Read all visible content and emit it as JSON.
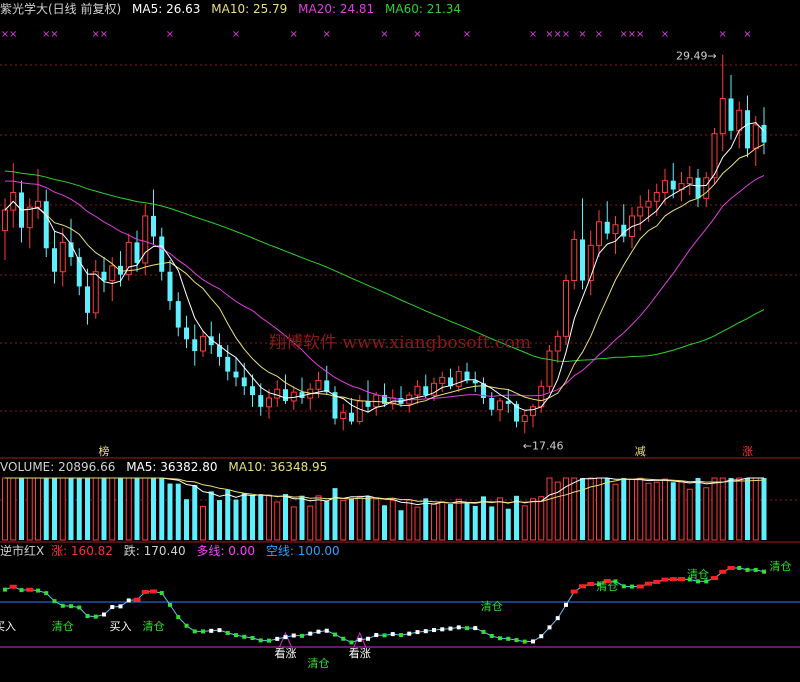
{
  "colors": {
    "up": "#ff3b3b",
    "down": "#5ff0ff",
    "ma5": "#ffffff",
    "ma10": "#e8e07a",
    "ma20": "#e040e0",
    "ma60": "#30d030",
    "rise": "#ff2020",
    "fall": "#00d0ff",
    "long": "#ff40ff",
    "short": "#3080ff",
    "grid": "#8b1a1a",
    "label": "#cccccc",
    "buy_line_blue": "#2a7fff",
    "buy_line_magenta": "#d030d0"
  },
  "price_header": {
    "name": "紫光学大(日线 前复权)",
    "ma5": "MA5: 26.63",
    "ma10": "MA10: 25.79",
    "ma20": "MA20: 24.81",
    "ma60": "MA60: 21.34"
  },
  "volume_header": {
    "title": "VOLUME: 20896.66",
    "ma5": "MA5: 36382.80",
    "ma10": "MA10: 36348.95"
  },
  "indicator_header": {
    "name": "逆市红X",
    "rise": "涨: 160.82",
    "fall": "跌: 170.40",
    "long": "多线: 0.00",
    "short": "空线: 100.00"
  },
  "watermark": "翔博软件 www.xiangbosoft.com",
  "chart_data": {
    "type": "candlestick",
    "annotations": {
      "high": "29.49",
      "low": "17.46",
      "markers": [
        "榜",
        "减",
        "涨"
      ],
      "indicator_labels": [
        "买入",
        "清仓",
        "买入",
        "清仓",
        "看涨",
        "清仓",
        "看涨",
        "清仓",
        "清仓",
        "清仓",
        "清仓"
      ]
    },
    "candles": [
      [
        23.5,
        24.6,
        22.5,
        24.2
      ],
      [
        24.2,
        25.8,
        23.6,
        24.8
      ],
      [
        24.8,
        25.2,
        23.1,
        23.6
      ],
      [
        23.6,
        24.6,
        22.9,
        24.3
      ],
      [
        24.3,
        25.6,
        23.9,
        24.5
      ],
      [
        24.5,
        24.9,
        22.6,
        22.9
      ],
      [
        22.9,
        23.5,
        21.7,
        22.1
      ],
      [
        22.1,
        23.6,
        21.6,
        23.1
      ],
      [
        23.1,
        23.9,
        22.3,
        22.6
      ],
      [
        22.6,
        22.9,
        21.3,
        21.6
      ],
      [
        21.6,
        22.2,
        20.3,
        20.7
      ],
      [
        20.7,
        22.5,
        20.5,
        22.1
      ],
      [
        22.1,
        22.6,
        21.4,
        21.8
      ],
      [
        21.8,
        22.6,
        21.1,
        22.3
      ],
      [
        22.3,
        22.8,
        21.6,
        22.0
      ],
      [
        22.0,
        23.4,
        21.8,
        23.1
      ],
      [
        23.1,
        23.5,
        22.1,
        22.4
      ],
      [
        22.4,
        24.4,
        22.0,
        24.0
      ],
      [
        24.0,
        24.9,
        23.0,
        23.3
      ],
      [
        23.3,
        23.6,
        21.8,
        22.1
      ],
      [
        22.1,
        22.5,
        20.8,
        21.1
      ],
      [
        21.1,
        21.4,
        19.9,
        20.2
      ],
      [
        20.2,
        20.6,
        19.5,
        19.8
      ],
      [
        19.8,
        20.3,
        18.9,
        19.4
      ],
      [
        19.4,
        20.1,
        19.2,
        19.9
      ],
      [
        19.9,
        20.4,
        19.3,
        19.6
      ],
      [
        19.6,
        20.0,
        18.9,
        19.2
      ],
      [
        19.2,
        19.6,
        18.4,
        18.7
      ],
      [
        18.7,
        19.2,
        18.2,
        18.5
      ],
      [
        18.5,
        19.0,
        17.9,
        18.2
      ],
      [
        18.2,
        18.6,
        17.5,
        17.9
      ],
      [
        17.9,
        18.3,
        17.2,
        17.5
      ],
      [
        17.5,
        18.1,
        17.1,
        17.8
      ],
      [
        17.8,
        18.4,
        17.5,
        18.1
      ],
      [
        18.1,
        18.6,
        17.6,
        17.7
      ],
      [
        17.7,
        18.2,
        17.4,
        18.0
      ],
      [
        18.0,
        18.5,
        17.6,
        17.8
      ],
      [
        17.8,
        18.3,
        17.4,
        18.1
      ],
      [
        18.1,
        18.7,
        17.8,
        18.4
      ],
      [
        18.4,
        18.9,
        17.9,
        18.0
      ],
      [
        18.0,
        18.2,
        16.9,
        17.1
      ],
      [
        17.1,
        17.6,
        16.7,
        17.3
      ],
      [
        17.3,
        17.8,
        16.9,
        17.0
      ],
      [
        17.0,
        17.9,
        16.9,
        17.7
      ],
      [
        17.7,
        18.4,
        17.3,
        17.5
      ],
      [
        17.5,
        18.0,
        17.2,
        17.9
      ],
      [
        17.9,
        18.3,
        17.5,
        17.6
      ],
      [
        17.6,
        18.1,
        17.4,
        17.8
      ],
      [
        17.8,
        18.2,
        17.5,
        17.6
      ],
      [
        17.6,
        18.0,
        17.3,
        17.9
      ],
      [
        17.9,
        18.4,
        17.6,
        18.2
      ],
      [
        18.2,
        18.6,
        17.8,
        17.9
      ],
      [
        17.9,
        18.5,
        17.7,
        18.3
      ],
      [
        18.3,
        18.7,
        18.0,
        18.5
      ],
      [
        18.5,
        18.8,
        18.1,
        18.2
      ],
      [
        18.2,
        18.9,
        18.0,
        18.7
      ],
      [
        18.7,
        19.0,
        18.3,
        18.4
      ],
      [
        18.4,
        18.7,
        18.0,
        18.3
      ],
      [
        18.3,
        18.5,
        17.6,
        17.8
      ],
      [
        17.8,
        18.0,
        17.2,
        17.4
      ],
      [
        17.4,
        17.8,
        17.0,
        17.7
      ],
      [
        17.7,
        18.1,
        17.3,
        17.6
      ],
      [
        17.6,
        17.7,
        16.8,
        17.0
      ],
      [
        17.0,
        17.4,
        16.6,
        17.2
      ],
      [
        17.2,
        17.6,
        16.8,
        17.5
      ],
      [
        17.5,
        18.4,
        17.3,
        18.2
      ],
      [
        18.2,
        19.6,
        18.0,
        19.4
      ],
      [
        19.4,
        20.1,
        19.0,
        19.9
      ],
      [
        19.9,
        22.0,
        19.6,
        21.8
      ],
      [
        21.8,
        23.5,
        21.5,
        23.2
      ],
      [
        23.2,
        24.6,
        21.5,
        21.8
      ],
      [
        21.8,
        23.5,
        21.3,
        23.0
      ],
      [
        23.0,
        24.2,
        22.6,
        23.8
      ],
      [
        23.8,
        24.5,
        23.2,
        23.4
      ],
      [
        23.4,
        24.0,
        22.7,
        23.7
      ],
      [
        23.7,
        24.4,
        23.1,
        23.3
      ],
      [
        23.3,
        24.3,
        22.9,
        24.0
      ],
      [
        24.0,
        24.7,
        23.5,
        24.3
      ],
      [
        24.3,
        24.9,
        23.8,
        24.5
      ],
      [
        24.5,
        25.1,
        24.0,
        24.8
      ],
      [
        24.8,
        25.6,
        24.4,
        25.2
      ],
      [
        25.2,
        25.8,
        24.6,
        24.9
      ],
      [
        24.9,
        25.5,
        24.5,
        25.1
      ],
      [
        25.1,
        25.7,
        24.7,
        25.3
      ],
      [
        25.3,
        25.6,
        24.3,
        24.6
      ],
      [
        24.6,
        25.5,
        24.3,
        25.3
      ],
      [
        25.3,
        27.0,
        25.1,
        26.8
      ],
      [
        26.8,
        29.49,
        26.2,
        28.0
      ],
      [
        28.0,
        28.8,
        26.6,
        26.9
      ],
      [
        26.9,
        27.9,
        26.3,
        27.6
      ],
      [
        27.6,
        28.1,
        26.0,
        26.3
      ],
      [
        26.3,
        27.4,
        25.7,
        27.1
      ],
      [
        27.1,
        27.7,
        26.1,
        26.5
      ]
    ]
  }
}
